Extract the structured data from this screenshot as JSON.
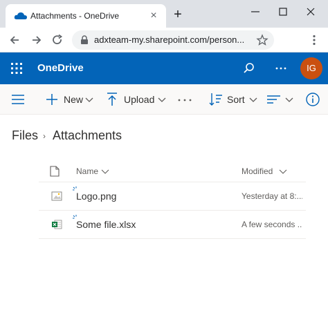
{
  "browser": {
    "tab_title": "Attachments - OneDrive",
    "tab_close": "×",
    "new_tab": "+",
    "url": "adxteam-my.sharepoint.com/person..."
  },
  "suite": {
    "brand": "OneDrive",
    "avatar_initials": "IG",
    "accent": "#0364b8",
    "avatar_color": "#ca5010"
  },
  "commands": {
    "new_label": "New",
    "upload_label": "Upload",
    "sort_label": "Sort"
  },
  "breadcrumb": {
    "root": "Files",
    "separator": "›",
    "current": "Attachments"
  },
  "list": {
    "columns": {
      "name": "Name",
      "modified": "Modified"
    },
    "rows": [
      {
        "name": "Logo.png",
        "modified": "Yesterday at 8:...",
        "icon": "image-file-icon"
      },
      {
        "name": "Some file.xlsx",
        "modified": "A few seconds ...",
        "icon": "excel-file-icon"
      }
    ]
  }
}
